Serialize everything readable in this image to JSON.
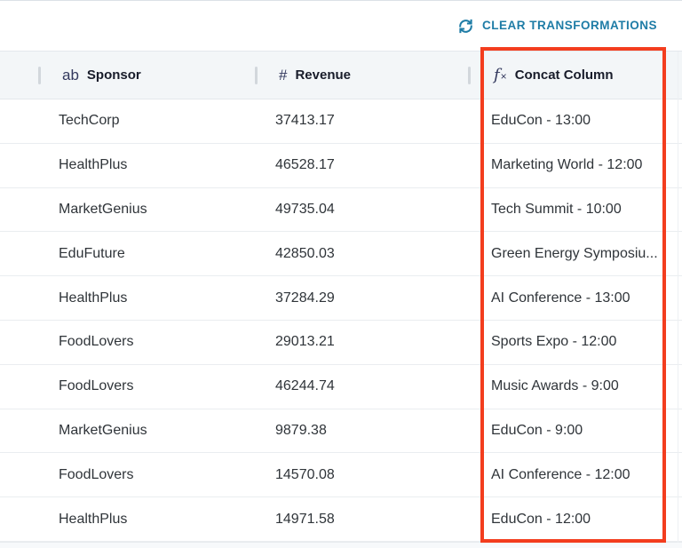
{
  "toolbar": {
    "clear_button": "CLEAR TRANSFORMATIONS"
  },
  "colors": {
    "accent_teal": "#1e7ca6",
    "highlight_red": "#f33d1e",
    "header_bg": "#f3f6f8",
    "row_border": "#eaedf0",
    "body_text": "#2f3439",
    "header_text": "#181c2a",
    "icon_navy": "#33395e"
  },
  "table": {
    "columns": [
      {
        "label": "Sponsor",
        "icon": "ab",
        "icon_name": "text-type-icon",
        "type": "text",
        "highlighted": false
      },
      {
        "label": "Revenue",
        "icon": "#",
        "icon_name": "number-type-icon",
        "type": "number",
        "highlighted": false
      },
      {
        "label": "Concat Column",
        "icon": "fx",
        "icon_name": "formula-type-icon",
        "type": "formula",
        "highlighted": true
      }
    ],
    "rows": [
      {
        "sponsor": "TechCorp",
        "revenue": "37413.17",
        "concat": "EduCon - 13:00"
      },
      {
        "sponsor": "HealthPlus",
        "revenue": "46528.17",
        "concat": "Marketing World - 12:00"
      },
      {
        "sponsor": "MarketGenius",
        "revenue": "49735.04",
        "concat": "Tech Summit - 10:00"
      },
      {
        "sponsor": "EduFuture",
        "revenue": "42850.03",
        "concat": "Green Energy Symposiu..."
      },
      {
        "sponsor": "HealthPlus",
        "revenue": "37284.29",
        "concat": "AI Conference - 13:00"
      },
      {
        "sponsor": "FoodLovers",
        "revenue": "29013.21",
        "concat": "Sports Expo - 12:00"
      },
      {
        "sponsor": "FoodLovers",
        "revenue": "46244.74",
        "concat": "Music Awards - 9:00"
      },
      {
        "sponsor": "MarketGenius",
        "revenue": "9879.38",
        "concat": "EduCon - 9:00"
      },
      {
        "sponsor": "FoodLovers",
        "revenue": "14570.08",
        "concat": "AI Conference - 12:00"
      },
      {
        "sponsor": "HealthPlus",
        "revenue": "14971.58",
        "concat": "EduCon - 12:00"
      }
    ]
  }
}
